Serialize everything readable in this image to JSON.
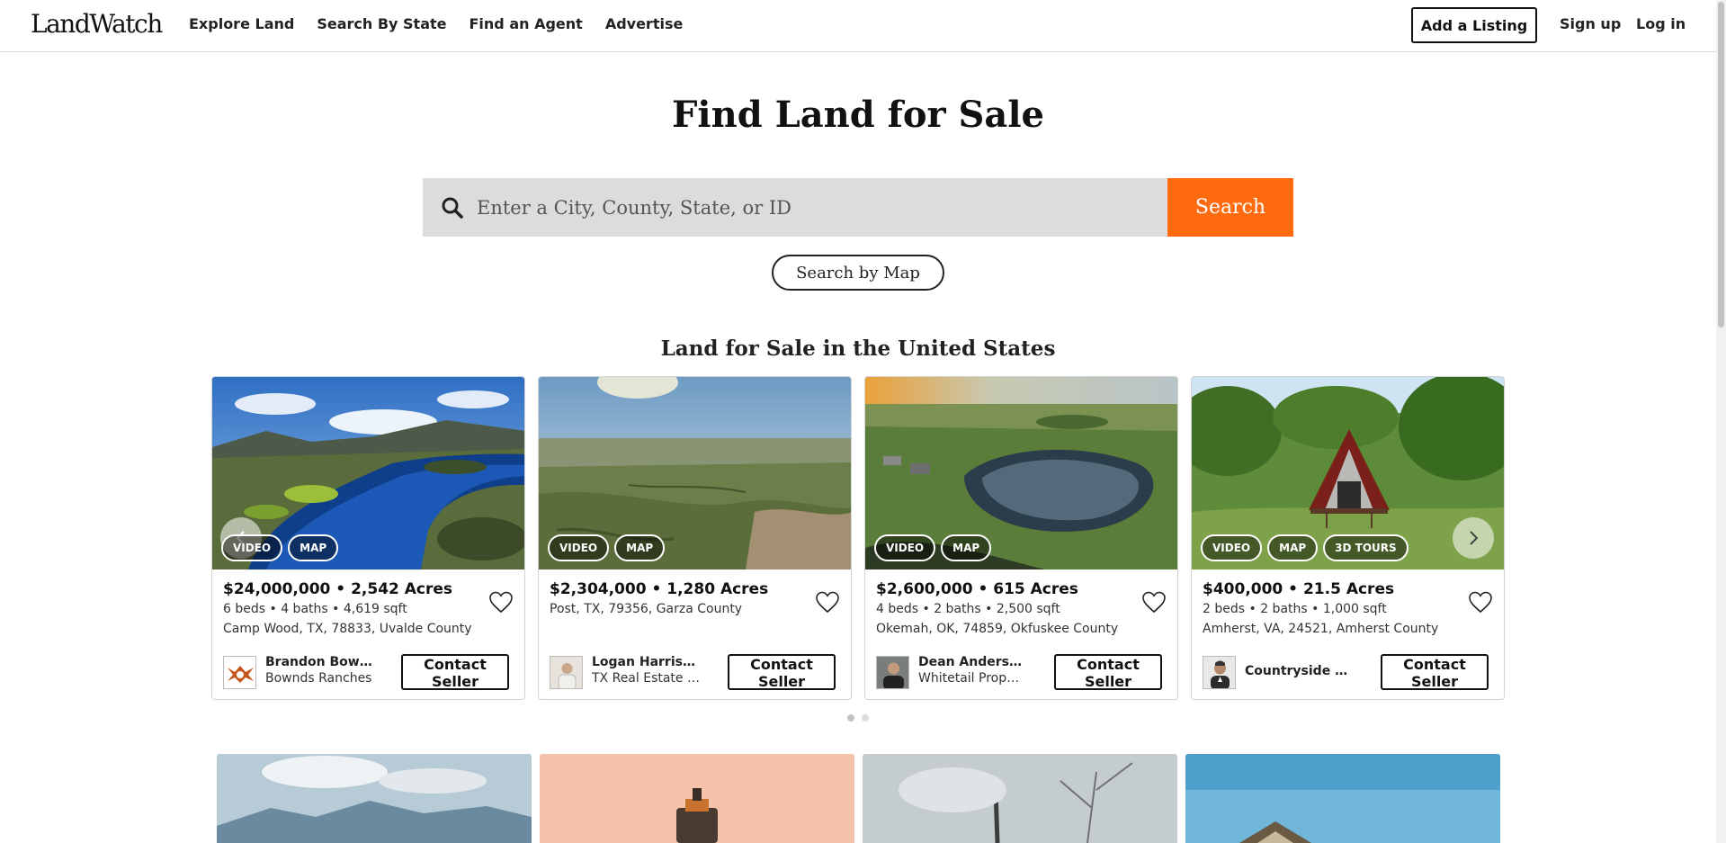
{
  "header": {
    "logo": "LandWatch",
    "nav": [
      "Explore Land",
      "Search By State",
      "Find an Agent",
      "Advertise"
    ],
    "add_listing": "Add a Listing",
    "sign_up": "Sign up",
    "log_in": "Log in"
  },
  "hero": {
    "title": "Find Land for Sale",
    "search_placeholder": "Enter a City, County, State, or ID",
    "search_button": "Search",
    "map_button": "Search by Map"
  },
  "section": {
    "title": "Land for Sale in the United States"
  },
  "listings": [
    {
      "badges": [
        "VIDEO",
        "MAP"
      ],
      "price": "$24,000,000 • 2,542 Acres",
      "specs": "6 beds • 4 baths • 4,619 sqft",
      "location": "Camp Wood, TX, 78833, Uvalde County",
      "agent_name": "Brandon Bownds",
      "agent_company": "Bownds Ranches",
      "contact": "Contact Seller"
    },
    {
      "badges": [
        "VIDEO",
        "MAP"
      ],
      "price": "$2,304,000 • 1,280 Acres",
      "specs": "",
      "location": "Post, TX, 79356, Garza County",
      "agent_name": "Logan Harrison",
      "agent_company": "TX Real Estate Gr...",
      "contact": "Contact Seller"
    },
    {
      "badges": [
        "VIDEO",
        "MAP"
      ],
      "price": "$2,600,000 • 615 Acres",
      "specs": "4 beds • 2 baths • 2,500 sqft",
      "location": "Okemah, OK, 74859, Okfuskee County",
      "agent_name": "Dean Anderson",
      "agent_company": "Whitetail Properti...",
      "contact": "Contact Seller"
    },
    {
      "badges": [
        "VIDEO",
        "MAP",
        "3D TOURS"
      ],
      "price": "$400,000 • 21.5 Acres",
      "specs": "2 beds • 2 baths • 1,000 sqft",
      "location": "Amherst, VA, 24521, Amherst County",
      "agent_name": "Countryside La...",
      "agent_company": "",
      "contact": "Contact Seller"
    }
  ],
  "icons": {
    "search": "search-icon",
    "heart": "heart-icon",
    "prev": "chevron-left-icon",
    "next": "chevron-right-icon"
  },
  "colors": {
    "accent": "#ff6b0e",
    "search_bg": "#dcdcdc"
  }
}
